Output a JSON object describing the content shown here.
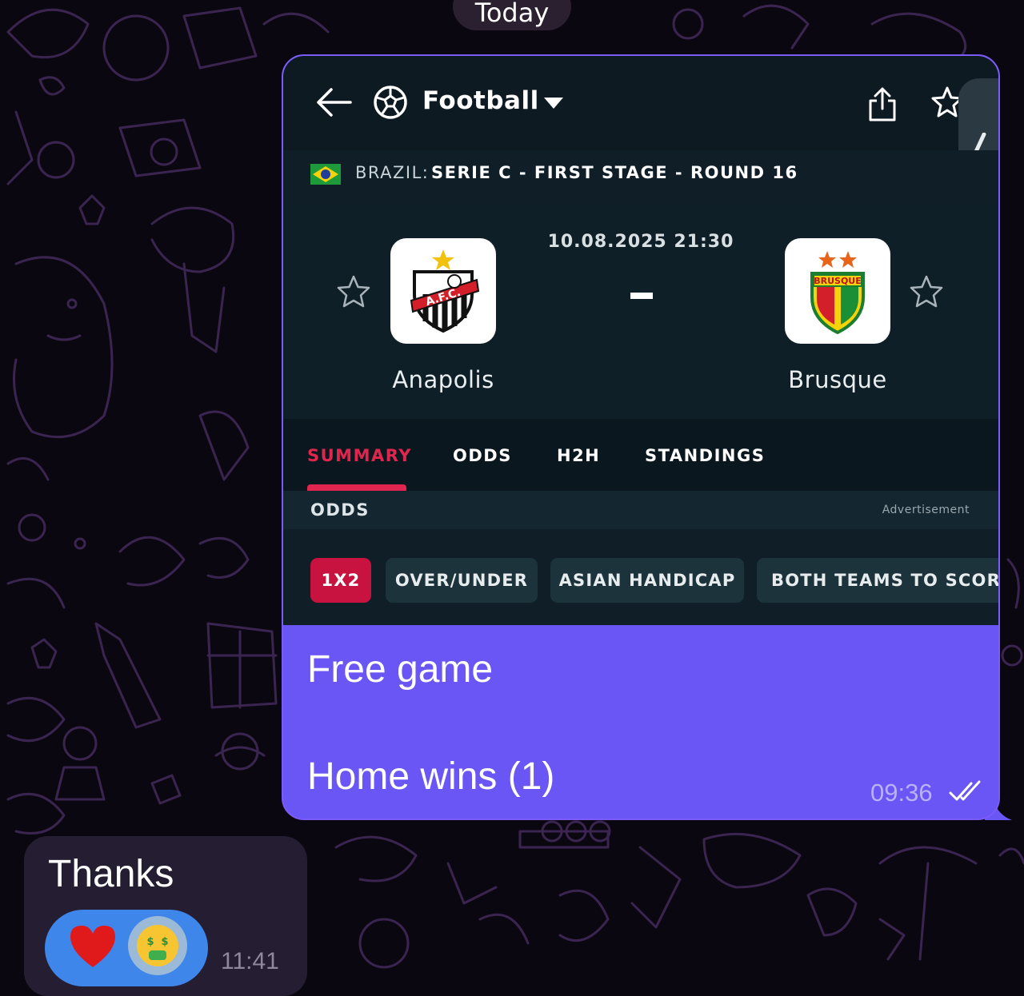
{
  "chat": {
    "date_label": "Today",
    "outgoing": {
      "lines": [
        "Free game",
        "Home wins (1)"
      ],
      "time": "09:36",
      "status_icon": "double-check-icon"
    },
    "incoming": {
      "text": "Thanks",
      "time": "11:41",
      "reactions": [
        "red-heart",
        "money-mouth-face"
      ]
    }
  },
  "screenshot": {
    "sport": "Football",
    "league": {
      "country": "BRAZIL:",
      "name": "SERIE C - FIRST STAGE - ROUND 16"
    },
    "match": {
      "datetime": "10.08.2025 21:30",
      "home_team": "Anapolis",
      "away_team": "Brusque",
      "score": "-"
    },
    "tabs": [
      "SUMMARY",
      "ODDS",
      "H2H",
      "STANDINGS"
    ],
    "active_tab": "SUMMARY",
    "odds_header": "ODDS",
    "ad_label": "Advertisement",
    "odds_chips": [
      "1X2",
      "OVER/UNDER",
      "ASIAN HANDICAP",
      "BOTH TEAMS TO SCORE"
    ],
    "active_chip": "1X2"
  },
  "colors": {
    "chat_bg": "#0b0710",
    "outgoing_bubble": "#6a55f5",
    "incoming_bubble": "#251d31",
    "accent_red": "#e0264f",
    "app_bg": "#0e1f28"
  }
}
